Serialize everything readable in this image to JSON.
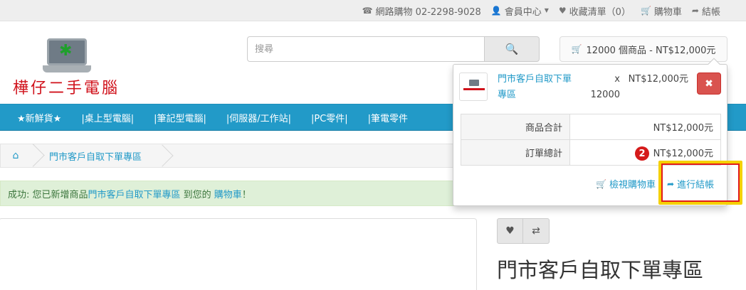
{
  "topbar": {
    "phone": "網路購物 02-2298-9028",
    "account": "會員中心",
    "wishlist": "收藏清單（0）",
    "cart": "購物車",
    "checkout": "結帳"
  },
  "logo": {
    "name": "樺仔二手電腦"
  },
  "search": {
    "placeholder": "搜尋"
  },
  "cart_button": {
    "label": "12000 個商品 - NT$12,000元"
  },
  "nav": {
    "items": [
      "★新鮮貨★",
      "|桌上型電腦|",
      "|筆記型電腦|",
      "|伺服器/工作站|",
      "|PC零件|",
      "|筆電零件"
    ]
  },
  "breadcrumb": {
    "item": "門市客戶自取下單專區"
  },
  "alert": {
    "prefix": "成功: 您已新增商品",
    "product": "門市客戶自取下單專區",
    "middle": " 到您的 ",
    "cart_link": "購物車",
    "suffix": "！"
  },
  "cart_dropdown": {
    "item": {
      "name": "門市客戶自取下單專區",
      "qty": "x 12000",
      "price": "NT$12,000元"
    },
    "totals": [
      {
        "label": "商品合計",
        "value": "NT$12,000元"
      },
      {
        "label": "訂單總計",
        "value": "NT$12,000元"
      }
    ],
    "view_cart": "檢視購物車",
    "checkout": "進行結帳"
  },
  "annotation": {
    "step": "2",
    "colors": {
      "border": "#f5d000",
      "inner": "#e11b1b",
      "badge": "#d51a1a"
    }
  },
  "product": {
    "title": "門市客戶自取下單專區"
  },
  "colors": {
    "accent": "#229ac8",
    "nav_bg": "#229ac8",
    "danger": "#d9534f",
    "alert_bg": "#dff0d8"
  }
}
